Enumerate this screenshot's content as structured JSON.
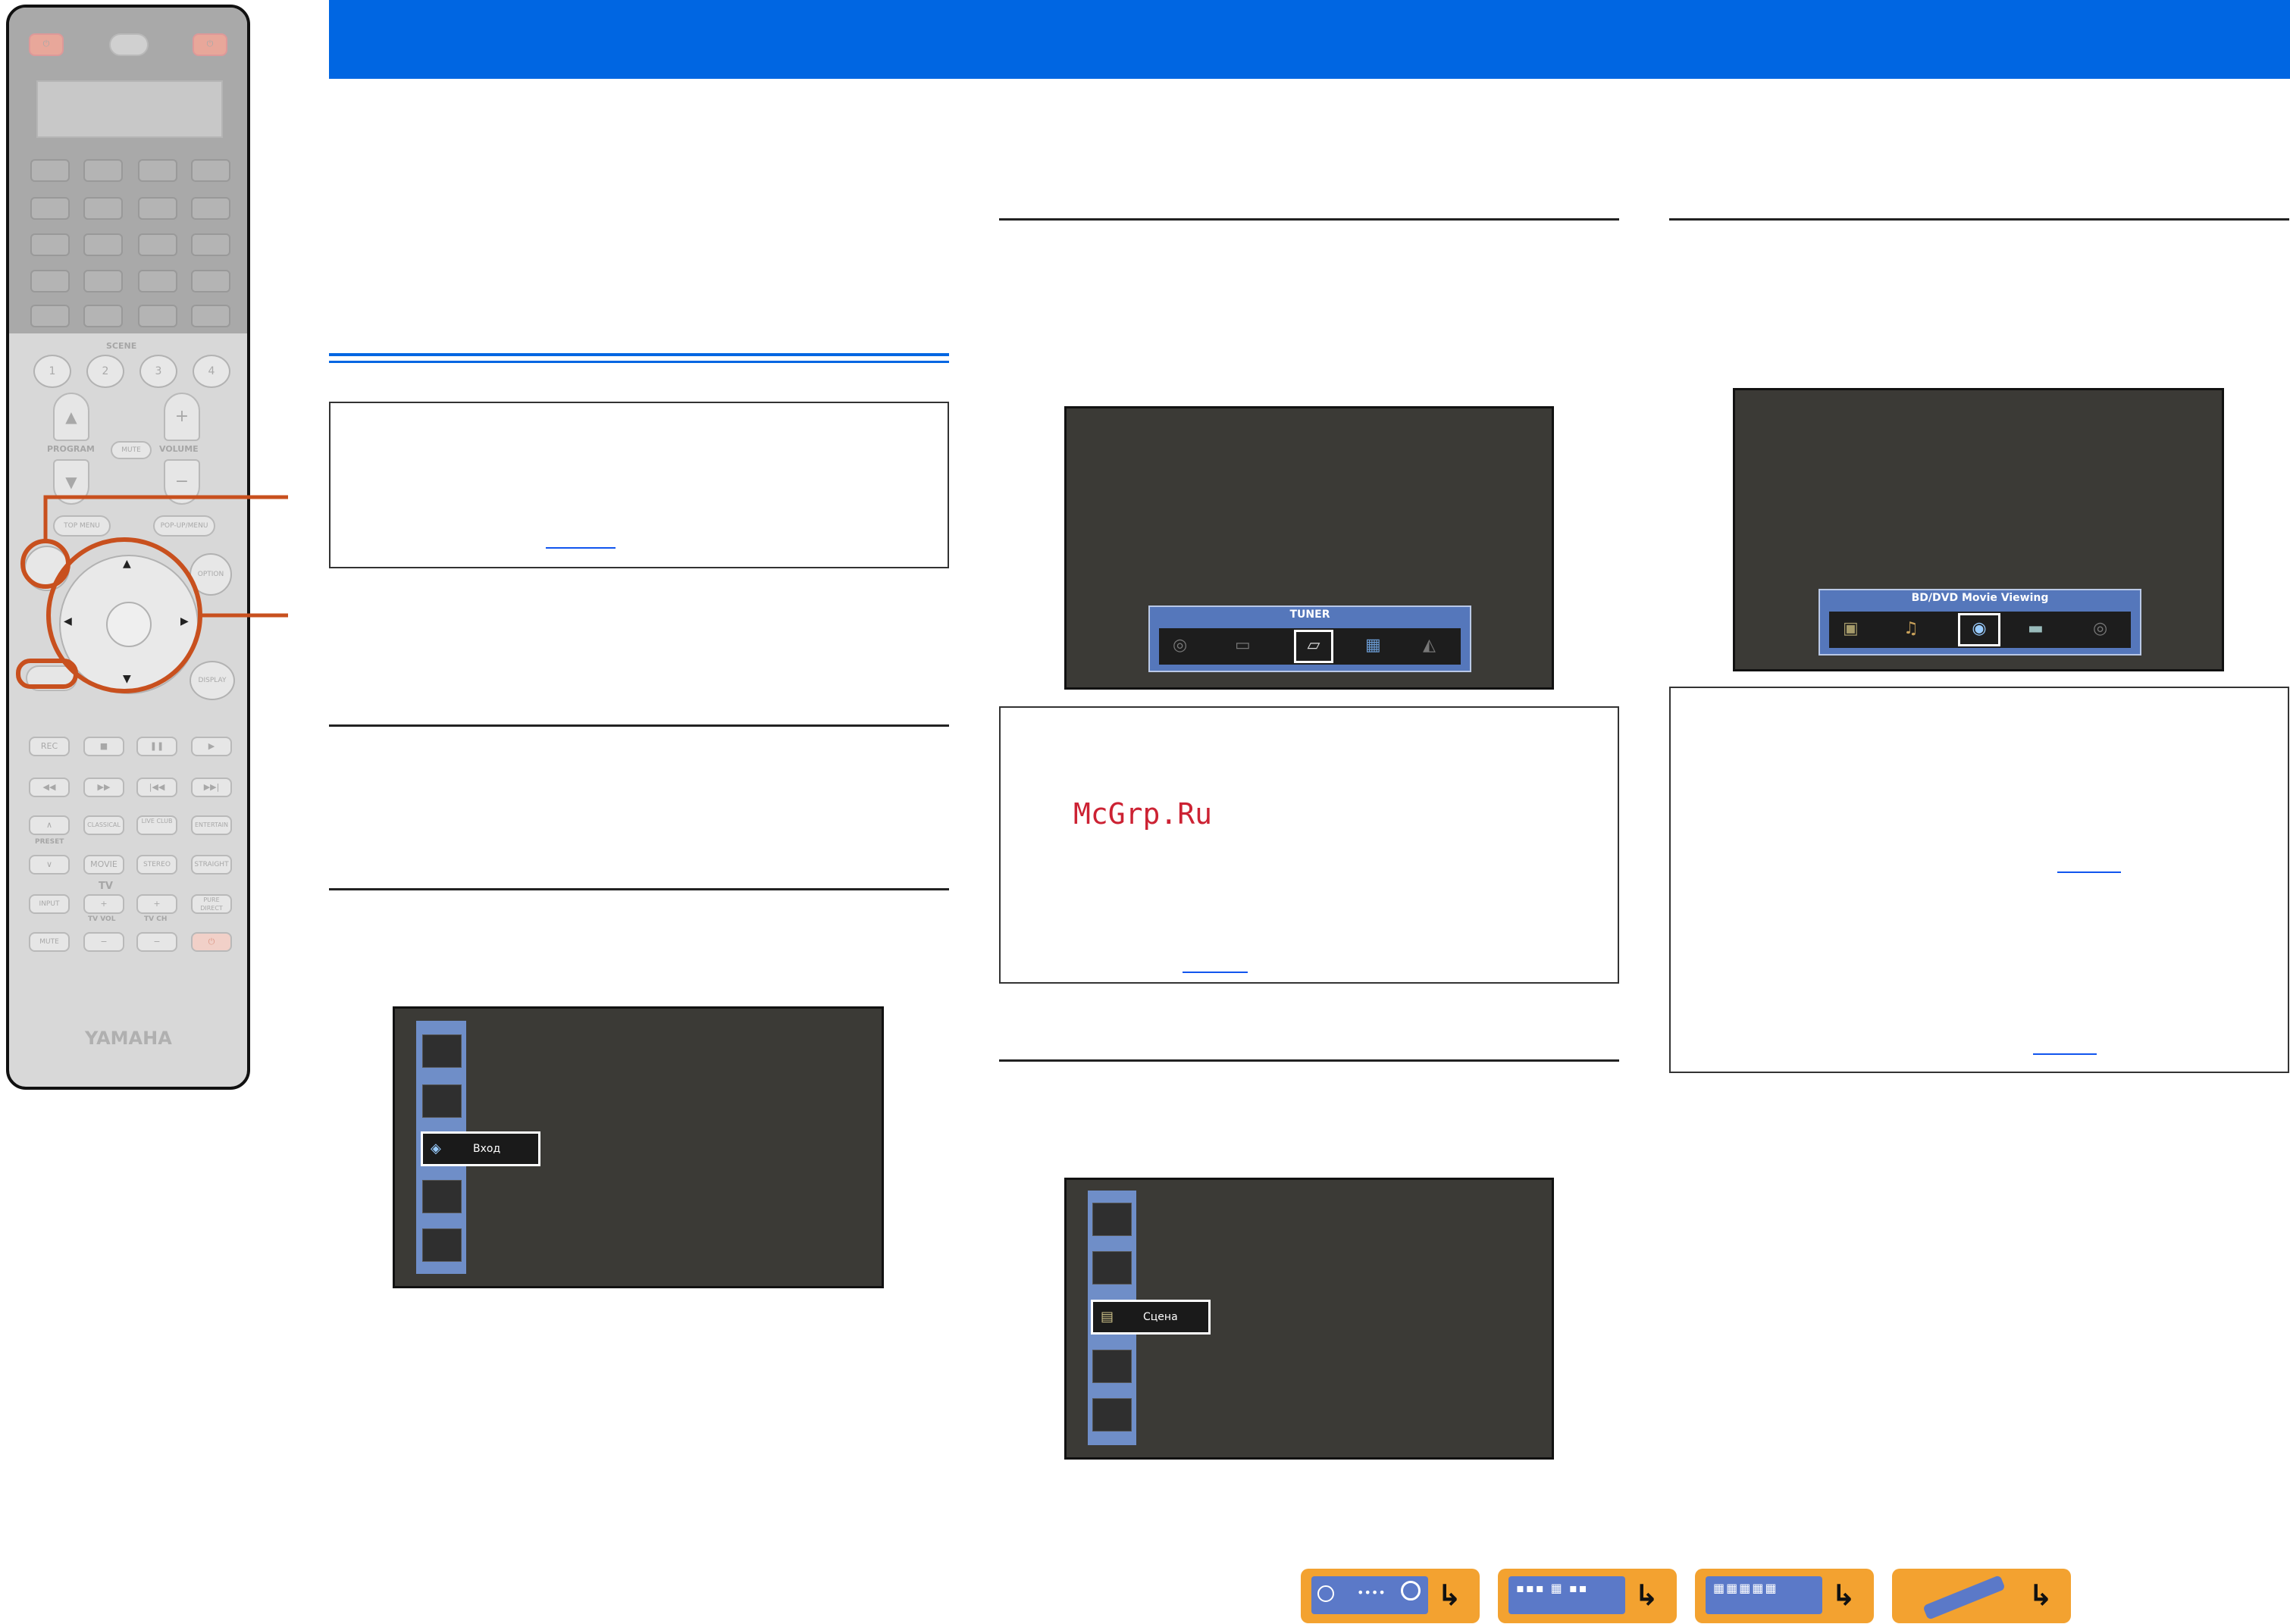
{
  "colors": {
    "header_blue": "#0066e2",
    "orange_highlight": "#c8501e",
    "screen_bg": "#3b3a36",
    "watermark_red": "#cc2233"
  },
  "remote": {
    "brand": "YAMAHA",
    "scene_label": "SCENE",
    "scene_buttons": [
      "1",
      "2",
      "3",
      "4"
    ],
    "program_label": "PROGRAM",
    "mute_small_label": "MUTE",
    "volume_label": "VOLUME",
    "plus": "+",
    "minus": "−",
    "top_menu": "TOP MENU",
    "popup_menu": "POP-UP/MENU",
    "option": "OPTION",
    "display": "DISPLAY",
    "rec": "REC",
    "preset_label": "PRESET",
    "classical": "CLASSICAL",
    "live_club": "LIVE CLUB",
    "entertain": "ENTERTAIN",
    "movie": "MOVIE",
    "stereo": "STEREO",
    "straight": "STRAIGHT",
    "tv_label": "TV",
    "input": "INPUT",
    "pure_direct": "PURE DIRECT",
    "tv_vol": "TV VOL",
    "tv_ch": "TV CH",
    "mute": "MUTE"
  },
  "screens": {
    "input_menu_item": "Вход",
    "scene_menu_item": "Сцена",
    "tuner_title": "TUNER",
    "bd_title": "BD/DVD Movie Viewing"
  },
  "watermark": "McGrp.Ru",
  "nav_icons": [
    "receiver-icon",
    "front-panel-icon",
    "rear-panel-icon",
    "remote-icon"
  ]
}
